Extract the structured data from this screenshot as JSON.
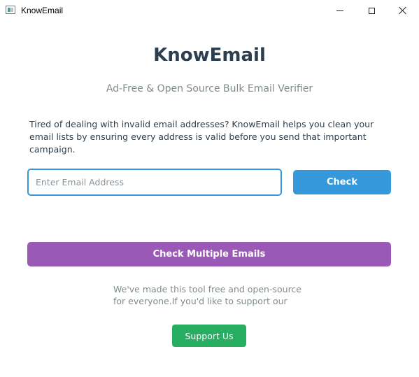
{
  "window": {
    "title": "KnowEmail"
  },
  "header": {
    "title": "KnowEmail",
    "subtitle": "Ad-Free & Open Source Bulk Email Verifier"
  },
  "description": "Tired of dealing with invalid email addresses? KnowEmail helps you clean your email lists by ensuring every address is valid before you send that important campaign.",
  "email_input": {
    "placeholder": "Enter Email Address",
    "value": ""
  },
  "buttons": {
    "check": "Check",
    "check_multiple": "Check Multiple Emails",
    "support": "Support Us"
  },
  "support_text": "We've made this tool free and open-source for everyone.If you'd like to support our",
  "colors": {
    "title": "#2c3e50",
    "subtitle": "#7f8c8d",
    "check_button": "#3498db",
    "check_multiple_button": "#9b59b6",
    "support_button": "#27ae60"
  },
  "icons": {
    "app": "app-window-icon",
    "minimize": "minimize-icon",
    "maximize": "maximize-icon",
    "close": "close-icon"
  }
}
